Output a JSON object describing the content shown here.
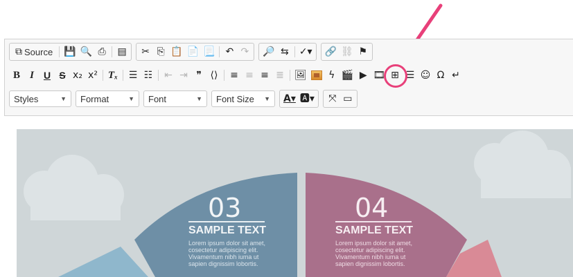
{
  "toolbar": {
    "row1": {
      "source_label": "Source"
    },
    "row3": {
      "styles": "Styles",
      "format": "Format",
      "font": "Font",
      "font_size": "Font Size"
    }
  },
  "infographic": {
    "segment3": {
      "number": "03",
      "title": "SAMPLE TEXT",
      "lines": [
        "Lorem ipsum dolor sit amet,",
        "cosectetur adipiscing elit.",
        "Vivamentum nibh iuma ut",
        "sapien dignissim lobortis."
      ]
    },
    "segment4": {
      "number": "04",
      "title": "SAMPLE TEXT",
      "lines": [
        "Lorem ipsum dolor sit amet,",
        "cosectetur adipiscing elit.",
        "Vivamentum nibh iuma ut",
        "sapien dignissim lobortis."
      ]
    }
  },
  "colors": {
    "arrow": "#e8407a",
    "segment3": "#6e8fa6",
    "segment4": "#a9708b",
    "segment_left": "#8fb7cc",
    "segment_right": "#d98a96",
    "background": "#cfd6d8"
  }
}
